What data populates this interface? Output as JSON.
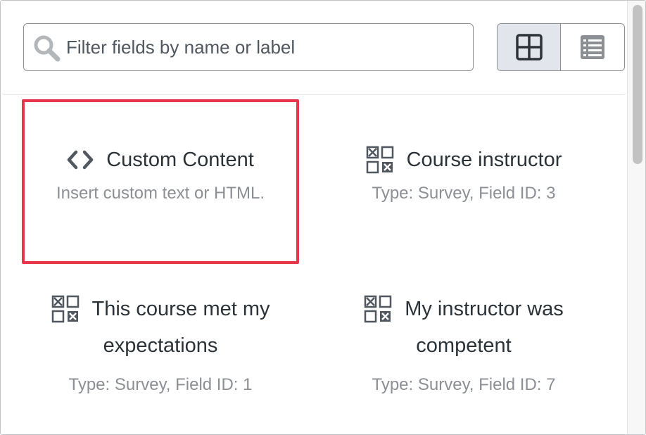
{
  "search": {
    "placeholder": "Filter fields by name or label",
    "value": ""
  },
  "view_toggle": {
    "grid_icon": "grid-view-icon",
    "list_icon": "list-view-icon",
    "active": "grid"
  },
  "fields": [
    {
      "title": "Custom Content",
      "description": "Insert custom text or HTML.",
      "icon": "code-icon",
      "selected": true
    },
    {
      "title": "Course instructor",
      "description": "Type: Survey, Field ID: 3",
      "icon": "survey-icon",
      "selected": false
    },
    {
      "title_line1": "This course met my",
      "title_line2": "expectations",
      "description": "Type: Survey, Field ID: 1",
      "icon": "survey-icon",
      "selected": false
    },
    {
      "title_line1": "My instructor was",
      "title_line2": "competent",
      "description": "Type: Survey, Field ID: 7",
      "icon": "survey-icon",
      "selected": false
    }
  ],
  "colors": {
    "highlight": "#e8374a",
    "active_toggle_bg": "#e2e6ec",
    "description_text": "#8c8f94"
  }
}
